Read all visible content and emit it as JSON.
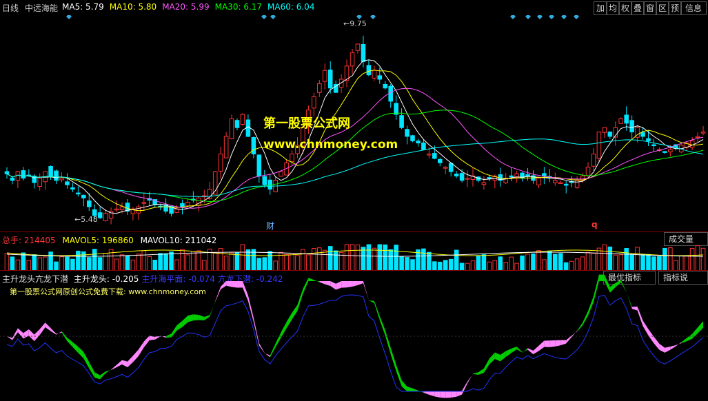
{
  "header": {
    "period": "日线",
    "stock": "中远海能",
    "ma_items": [
      {
        "label": "MA5: 5.79",
        "color": "#ffffff"
      },
      {
        "label": "MA10: 5.80",
        "color": "#ffff00"
      },
      {
        "label": "MA20: 5.99",
        "color": "#ff55ff"
      },
      {
        "label": "MA30: 6.17",
        "color": "#00ff00"
      },
      {
        "label": "MA60: 6.04",
        "color": "#00ffff"
      }
    ],
    "buttons": [
      "加",
      "均",
      "权",
      "叠",
      "窗",
      "区",
      "预",
      "信息"
    ]
  },
  "price_chart": {
    "high_label": "9.75",
    "low_label": "5.48",
    "watermark_title": "第一股票公式网",
    "watermark_url": "www.chnmoney.com",
    "marker_cai": "财",
    "marker_q": "q"
  },
  "volume_panel": {
    "label_total": "总手: ",
    "total_value": "214405",
    "mavol5": "MAVOL5: 196860",
    "mavol10": "MAVOL10: 211042",
    "button": "成交量"
  },
  "indicator_panel": {
    "title": "主升龙头亢龙下潜",
    "items": [
      {
        "label": "主升龙头: -0.205",
        "color": "#ffffff"
      },
      {
        "label": "主升海平面: -0.074",
        "color": "#3a3aff"
      },
      {
        "label": "亢龙下潜: -0.242",
        "color": "#3a3aff"
      }
    ],
    "note": "第一股票公式网原创公式免费下载: www.chnmoney.com",
    "buttons": [
      "最优指标",
      "指标说"
    ]
  },
  "chart_data": {
    "type": "candlestick",
    "price_range": [
      5.3,
      10.0
    ],
    "high": 9.75,
    "low": 5.48,
    "closes": [
      6.55,
      6.4,
      6.6,
      6.45,
      6.5,
      6.35,
      6.45,
      6.6,
      6.5,
      6.4,
      6.45,
      6.3,
      6.2,
      6.1,
      6.0,
      5.8,
      5.6,
      5.55,
      5.65,
      5.7,
      5.75,
      5.8,
      5.7,
      5.75,
      5.8,
      5.9,
      5.95,
      5.85,
      5.8,
      5.7,
      5.65,
      5.75,
      5.8,
      5.9,
      5.95,
      6.0,
      6.05,
      6.2,
      6.6,
      7.0,
      7.4,
      7.8,
      7.6,
      7.9,
      7.4,
      7.0,
      6.5,
      6.3,
      6.2,
      6.4,
      6.6,
      6.8,
      7.0,
      7.2,
      7.6,
      8.0,
      8.3,
      8.6,
      8.9,
      8.5,
      8.4,
      8.7,
      9.0,
      9.3,
      9.5,
      9.1,
      8.8,
      8.9,
      8.7,
      8.5,
      8.2,
      7.9,
      7.6,
      7.4,
      7.3,
      7.25,
      7.1,
      7.0,
      6.9,
      6.8,
      6.7,
      6.6,
      6.5,
      6.4,
      6.45,
      6.5,
      6.4,
      6.35,
      6.45,
      6.5,
      6.4,
      6.45,
      6.5,
      6.55,
      6.45,
      6.5,
      6.4,
      6.45,
      6.5,
      6.45,
      6.4,
      6.35,
      6.3,
      6.35,
      6.4,
      6.5,
      6.7,
      7.0,
      7.5,
      7.6,
      7.4,
      7.6,
      7.8,
      7.7,
      7.5,
      7.6,
      7.4,
      7.3,
      7.2,
      7.1,
      7.05,
      7.1,
      7.15,
      7.2,
      7.25,
      7.3,
      7.4,
      7.5
    ],
    "volume_range": [
      0,
      80000
    ],
    "indicator_range": [
      -1,
      1
    ]
  }
}
